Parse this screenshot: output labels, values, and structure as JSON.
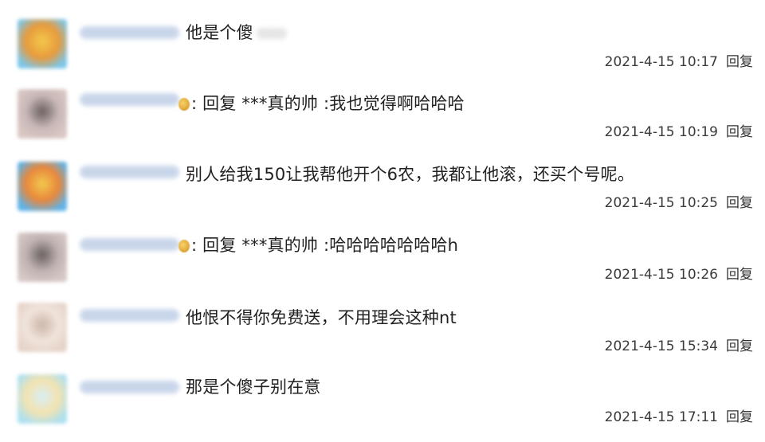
{
  "comments": [
    {
      "text": "他是个傻",
      "timestamp": "2021-4-15 10:17",
      "reply_label": "回复",
      "avatar_colors": [
        "#7cc6e8",
        "#f2c94c",
        "#e89a3c"
      ],
      "username_color": "#c9d6ea",
      "has_emoji": false,
      "has_blur_tail": true
    },
    {
      "text": ": 回复 ***真的帅 :我也觉得啊哈哈哈",
      "timestamp": "2021-4-15 10:19",
      "reply_label": "回复",
      "avatar_colors": [
        "#d9c7c2",
        "#6b6060",
        "#c9b8b8"
      ],
      "username_color": "#c9d6ea",
      "has_emoji": true,
      "has_blur_tail": false
    },
    {
      "text": "别人给我150让我帮他开个6农，我都让他滚，还买个号呢。",
      "timestamp": "2021-4-15 10:25",
      "reply_label": "回复",
      "avatar_colors": [
        "#5fb3e8",
        "#f2c94c",
        "#e8873c"
      ],
      "username_color": "#c9d6ea",
      "has_emoji": false,
      "has_blur_tail": false
    },
    {
      "text": ": 回复 ***真的帅 :哈哈哈哈哈哈哈h",
      "timestamp": "2021-4-15 10:26",
      "reply_label": "回复",
      "avatar_colors": [
        "#d5c8c6",
        "#6a6262",
        "#c2b3b3"
      ],
      "username_color": "#c9d6ea",
      "has_emoji": true,
      "has_blur_tail": false
    },
    {
      "text": "他恨不得你免费送，不用理会这种nt",
      "timestamp": "2021-4-15 15:34",
      "reply_label": "回复",
      "avatar_colors": [
        "#e6d3c8",
        "#cdb6a8",
        "#f0e4dc"
      ],
      "username_color": "#c9d6ea",
      "has_emoji": false,
      "has_blur_tail": false
    },
    {
      "text": "那是个傻子别在意",
      "timestamp": "2021-4-15 17:11",
      "reply_label": "回复",
      "avatar_colors": [
        "#aee0f0",
        "#d8eef6",
        "#f3e3b0"
      ],
      "username_color": "#c9d6ea",
      "has_emoji": false,
      "has_blur_tail": false
    }
  ]
}
